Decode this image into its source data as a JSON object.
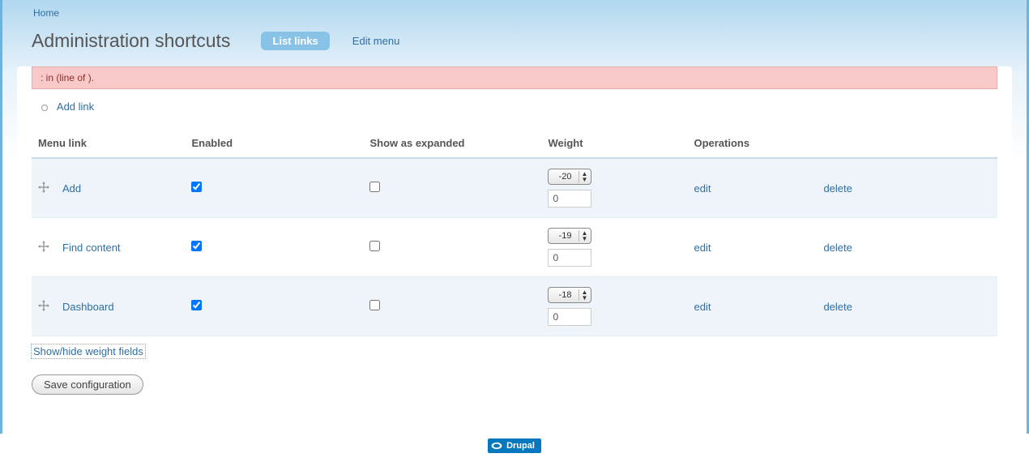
{
  "breadcrumb": {
    "home": "Home"
  },
  "page": {
    "title": "Administration shortcuts"
  },
  "tabs": {
    "list_links": "List links",
    "edit_menu": "Edit menu"
  },
  "message": {
    "error": ": in (line of )."
  },
  "actions": {
    "add_link": "Add link"
  },
  "table": {
    "headers": {
      "menu_link": "Menu link",
      "enabled": "Enabled",
      "show_expanded": "Show as expanded",
      "weight": "Weight",
      "operations": "Operations"
    },
    "rows": [
      {
        "label": "Add",
        "enabled": true,
        "expanded": false,
        "weight": "-20",
        "weight_text": "0",
        "edit": "edit",
        "delete": "delete"
      },
      {
        "label": "Find content",
        "enabled": true,
        "expanded": false,
        "weight": "-19",
        "weight_text": "0",
        "edit": "edit",
        "delete": "delete"
      },
      {
        "label": "Dashboard",
        "enabled": true,
        "expanded": false,
        "weight": "-18",
        "weight_text": "0",
        "edit": "edit",
        "delete": "delete"
      }
    ]
  },
  "toggles": {
    "show_hide_weights": "Show/hide weight fields"
  },
  "buttons": {
    "save": "Save configuration"
  },
  "footer": {
    "badge": "Drupal"
  }
}
